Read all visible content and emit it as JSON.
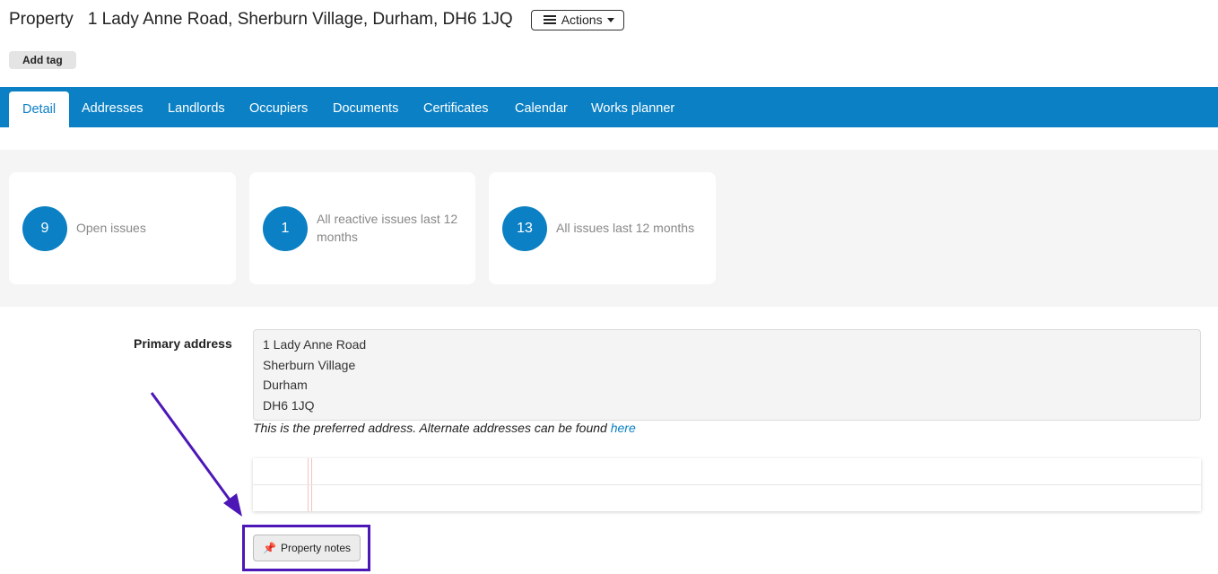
{
  "header": {
    "page_label": "Property",
    "address": "1 Lady Anne Road, Sherburn Village, Durham, DH6 1JQ",
    "actions_label": "Actions"
  },
  "tag_button": "Add tag",
  "tabs": [
    {
      "label": "Detail",
      "active": true
    },
    {
      "label": "Addresses"
    },
    {
      "label": "Landlords"
    },
    {
      "label": "Occupiers"
    },
    {
      "label": "Documents"
    },
    {
      "label": "Certificates"
    },
    {
      "label": "Calendar"
    },
    {
      "label": "Works planner"
    }
  ],
  "stats": [
    {
      "value": "9",
      "label": "Open issues"
    },
    {
      "value": "1",
      "label": "All reactive issues last 12 months"
    },
    {
      "value": "13",
      "label": "All issues last 12 months"
    }
  ],
  "primary_address": {
    "label": "Primary address",
    "lines": [
      "1 Lady Anne Road",
      "Sherburn Village",
      "Durham",
      "DH6 1JQ"
    ],
    "note": "This is the preferred address. Alternate addresses can be found",
    "link": "here"
  },
  "notes_button": "Property notes",
  "colors": {
    "accent": "#0b80c4",
    "highlight": "#4d17b8"
  }
}
